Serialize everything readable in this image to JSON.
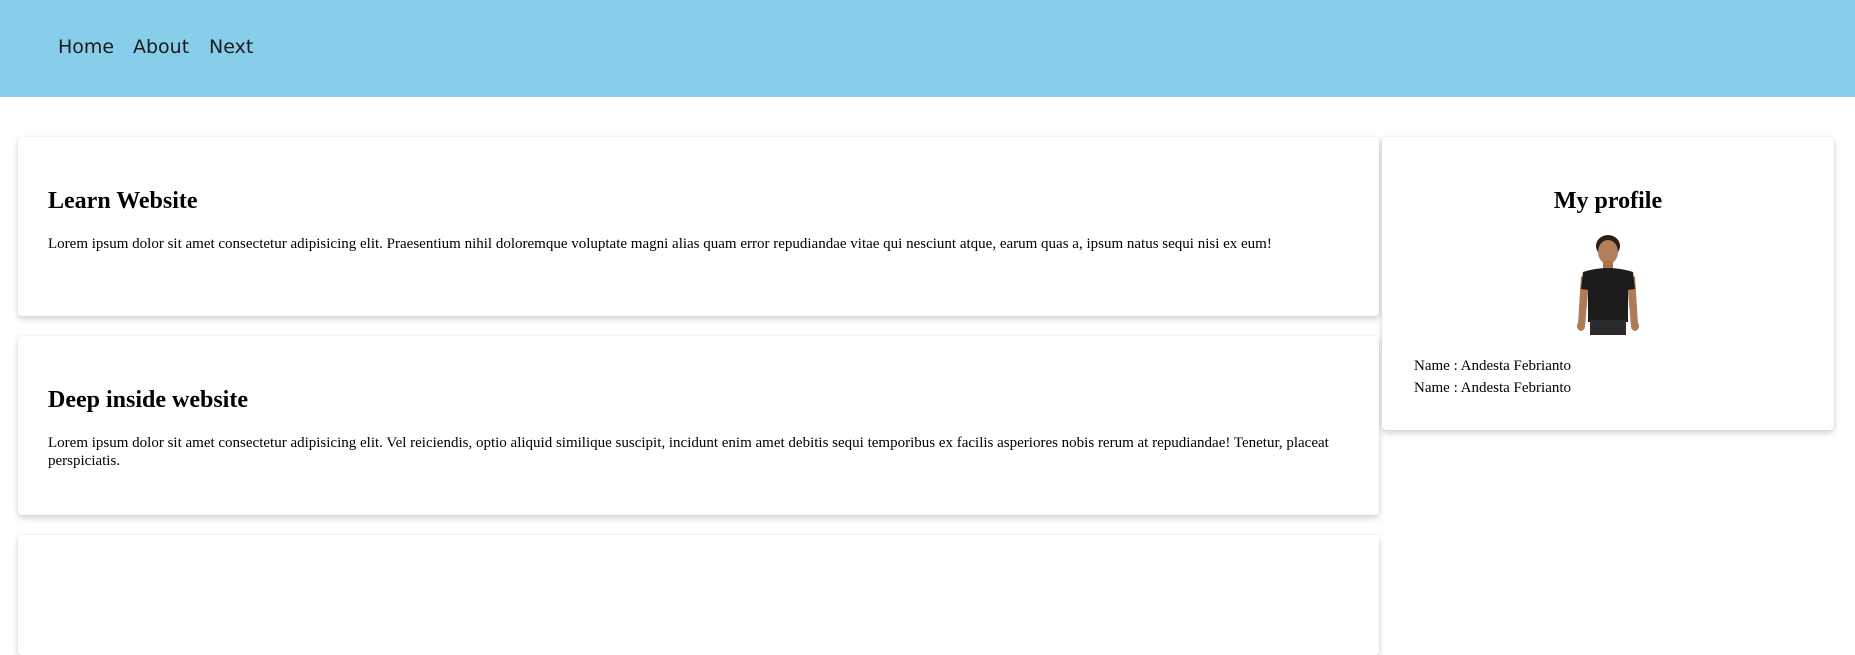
{
  "nav": {
    "items": [
      {
        "label": "Home"
      },
      {
        "label": "About"
      },
      {
        "label": "Next"
      }
    ]
  },
  "articles": [
    {
      "title": "Learn Website",
      "body": "Lorem ipsum dolor sit amet consectetur adipisicing elit. Praesentium nihil doloremque voluptate magni alias quam error repudiandae vitae qui nesciunt atque, earum quas a, ipsum natus sequi nisi ex eum!"
    },
    {
      "title": "Deep inside website",
      "body": "Lorem ipsum dolor sit amet consectetur adipisicing elit. Vel reiciendis, optio aliquid similique suscipit, incidunt enim amet debitis sequi temporibus ex facilis asperiores nobis rerum at repudiandae! Tenetur, placeat perspiciatis."
    }
  ],
  "profile": {
    "title": "My profile",
    "lines": [
      "Name : Andesta Febrianto",
      "Name : Andesta Febrianto"
    ]
  },
  "colors": {
    "navbar": "#87ceeb",
    "card": "#ffffff"
  }
}
